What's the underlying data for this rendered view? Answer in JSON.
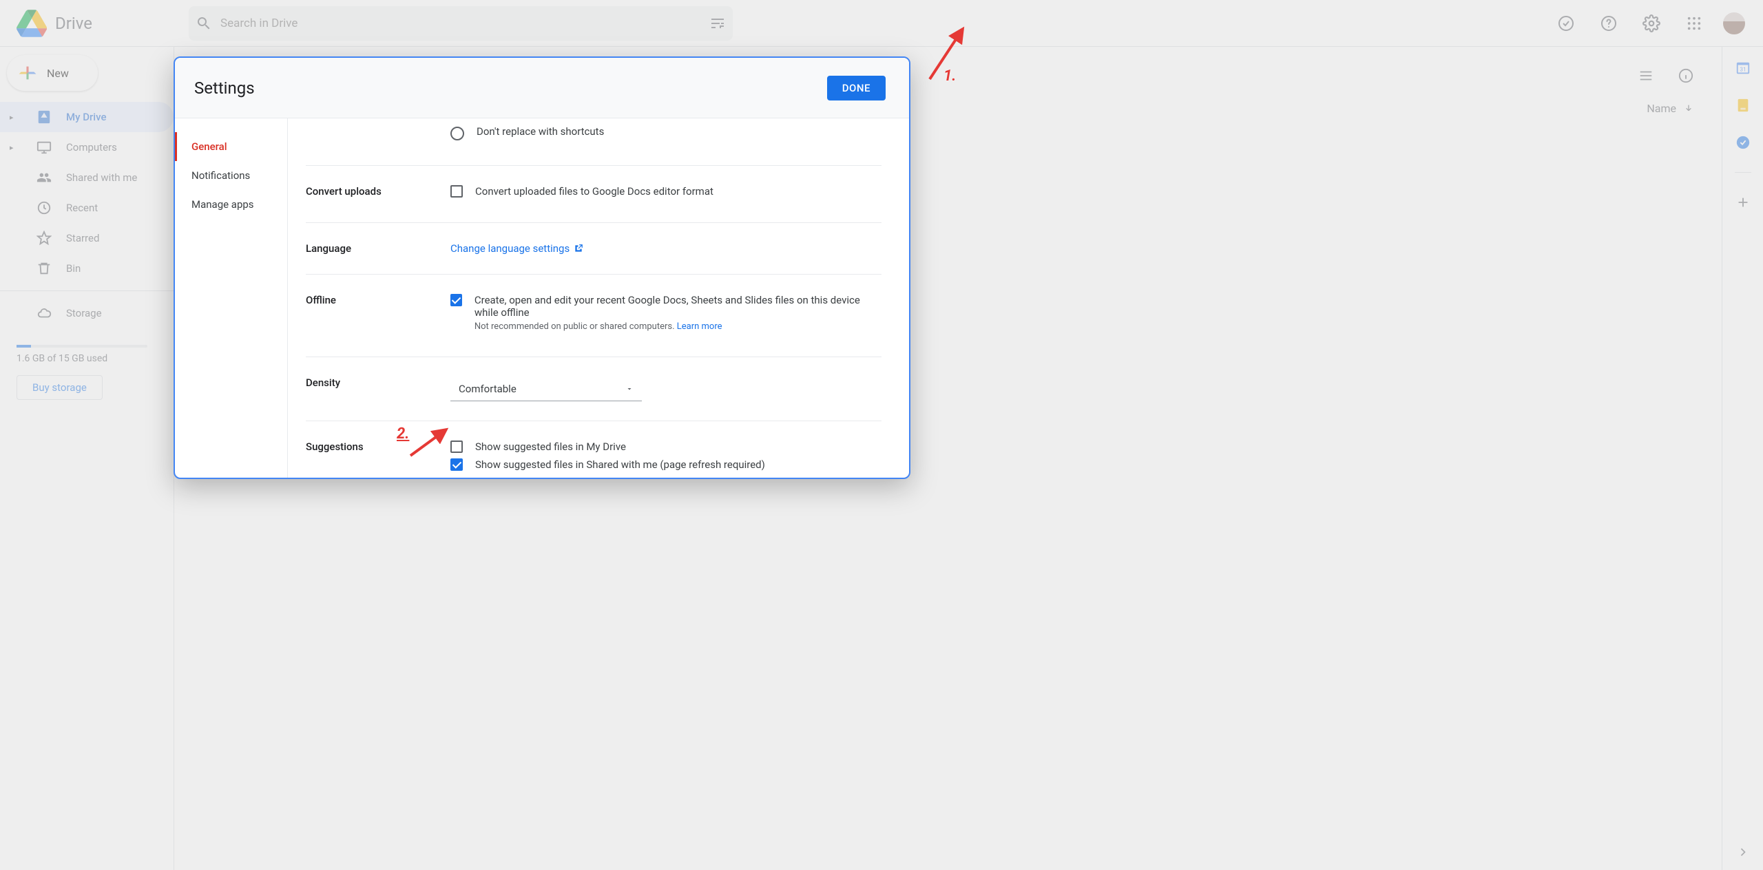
{
  "app": {
    "name": "Drive"
  },
  "search": {
    "placeholder": "Search in Drive"
  },
  "new_button": "New",
  "nav": {
    "my_drive": "My Drive",
    "computers": "Computers",
    "shared": "Shared with me",
    "recent": "Recent",
    "starred": "Starred",
    "bin": "Bin"
  },
  "storage": {
    "label": "Storage",
    "used_text": "1.6 GB of 15 GB used",
    "buy": "Buy storage"
  },
  "list": {
    "sort_column": "Name"
  },
  "modal": {
    "title": "Settings",
    "done": "DONE",
    "nav": {
      "general": "General",
      "notifications": "Notifications",
      "manage_apps": "Manage apps"
    },
    "shortcuts": {
      "option_dont_replace": "Don't replace with shortcuts"
    },
    "convert": {
      "label": "Convert uploads",
      "option": "Convert uploaded files to Google Docs editor format"
    },
    "language": {
      "label": "Language",
      "link": "Change language settings"
    },
    "offline": {
      "label": "Offline",
      "option": "Create, open and edit your recent Google Docs, Sheets and Slides files on this device while offline",
      "note_prefix": "Not recommended on public or shared computers. ",
      "learn_more": "Learn more"
    },
    "density": {
      "label": "Density",
      "value": "Comfortable"
    },
    "suggestions": {
      "label": "Suggestions",
      "opt1": "Show suggested files in My Drive",
      "opt2": "Show suggested files in Shared with me (page refresh required)"
    }
  },
  "annotations": {
    "one": "1.",
    "two": "2."
  }
}
